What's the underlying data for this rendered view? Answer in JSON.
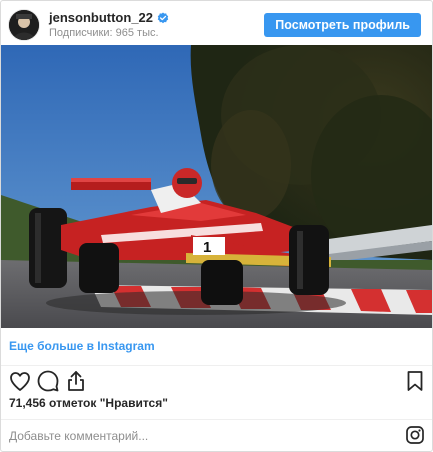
{
  "header": {
    "username": "jensonbutton_22",
    "followers": "Подписчики: 965 тыс.",
    "view_profile_label": "Посмотреть профиль"
  },
  "post": {
    "more_link": "Еще больше в Instagram",
    "likes": "71,456 отметок \"Нравится\"",
    "comment_placeholder": "Добавьте комментарий..."
  },
  "colors": {
    "accent": "#3897f0",
    "text": "#262626",
    "muted": "#8e8e8e",
    "border": "#dbdbdb"
  },
  "icons": {
    "verified": "verified-badge-icon",
    "like": "heart-icon",
    "comment": "comment-bubble-icon",
    "share": "share-icon",
    "save": "bookmark-icon",
    "instagram": "instagram-logo-icon"
  }
}
